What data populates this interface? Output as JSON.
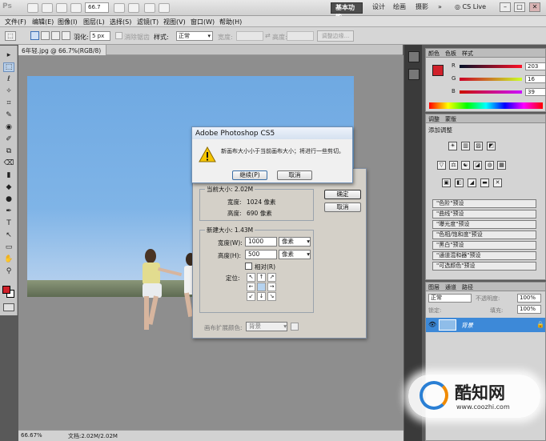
{
  "app": {
    "logo": "Ps",
    "zoom": "66.7",
    "workspaces": [
      "基本功能",
      "设计",
      "绘画",
      "摄影"
    ],
    "more": "»",
    "cs_live": "CS Live",
    "window_buttons": [
      "–",
      "□",
      "✕"
    ]
  },
  "menu": [
    "文件(F)",
    "编辑(E)",
    "图像(I)",
    "图层(L)",
    "选择(S)",
    "滤镜(T)",
    "视图(V)",
    "窗口(W)",
    "帮助(H)"
  ],
  "options": {
    "feather_label": "羽化:",
    "feather_value": "5 px",
    "antialias_label": "消除锯齿",
    "style_label": "样式:",
    "style_value": "正常",
    "width_label": "宽度:",
    "height_label": "高度:",
    "refine_button": "调整边缘..."
  },
  "tools": [
    "▸",
    "⬚",
    "ℓ",
    "✧",
    "⌗",
    "✎",
    "◉",
    "✐",
    "⧉",
    "⌫",
    "▮",
    "◆",
    "●",
    "✒",
    "T",
    "↖",
    "▭",
    "✋",
    "⚲"
  ],
  "document": {
    "tab_title": "6年轻.jpg @ 66.7%(RGB/8)",
    "tab_close": "×",
    "status_zoom": "66.67%",
    "status_doc": "文档:2.02M/2.02M"
  },
  "color_panel": {
    "tabs": [
      "颜色",
      "色板",
      "样式"
    ],
    "foreground": "#d0202a",
    "channels": [
      {
        "label": "R",
        "value": "203",
        "gradient": "linear-gradient(90deg,#001027,#ff1027)"
      },
      {
        "label": "G",
        "value": "16",
        "gradient": "linear-gradient(90deg,#cb0027,#cbff27)"
      },
      {
        "label": "B",
        "value": "39",
        "gradient": "linear-gradient(90deg,#cb1000,#cb10ff)"
      }
    ]
  },
  "adjustments_panel": {
    "tabs": [
      "调整",
      "蒙版"
    ],
    "title": "添加调整",
    "icons_row1": [
      "☀",
      "▥",
      "▨",
      "◩"
    ],
    "icons_row2": [
      "▽",
      "⚖",
      "☯",
      "◪",
      "◍",
      "▦"
    ],
    "icons_row3": [
      "▣",
      "◧",
      "◢",
      "▬",
      "✕"
    ],
    "presets": [
      "\"色阶\"预设",
      "\"曲线\"预设",
      "\"曝光度\"预设",
      "\"色相/饱和度\"预设",
      "\"黑白\"预设",
      "\"通道混和器\"预设",
      "\"可选颜色\"预设"
    ]
  },
  "layers_panel": {
    "tabs": [
      "图层",
      "通道",
      "路径"
    ],
    "mode": "正常",
    "opacity_label": "不透明度:",
    "opacity_value": "100%",
    "lock_label": "锁定:",
    "fill_label": "填充:",
    "fill_value": "100%",
    "layer_name": "背景"
  },
  "alert": {
    "title": "Adobe Photoshop CS5",
    "message": "新画布大小小于当前画布大小；将进行一些剪切。",
    "continue": "继续(P)",
    "cancel": "取消"
  },
  "canvas_dialog": {
    "current_size_legend": "当前大小: 2.02M",
    "width_label": "宽度:",
    "width_value": "1024 像素",
    "height_label": "高度:",
    "height_value": "690 像素",
    "new_size_legend": "新建大小: 1.43M",
    "new_width_label": "宽度(W):",
    "new_width": "1000",
    "new_height_label": "高度(H):",
    "new_height": "500",
    "unit": "像素",
    "relative": "相对(R)",
    "anchor_label": "定位:",
    "anchor_cells": [
      "↖",
      "↑",
      "↗",
      "←",
      "",
      "→",
      "↙",
      "↓",
      "↘"
    ],
    "ext_color_label": "画布扩展颜色:",
    "ext_color_value": "背景",
    "ok": "确定",
    "cancel": "取消"
  },
  "watermark": {
    "brand": "酷知网",
    "url": "www.coozhi.com"
  }
}
